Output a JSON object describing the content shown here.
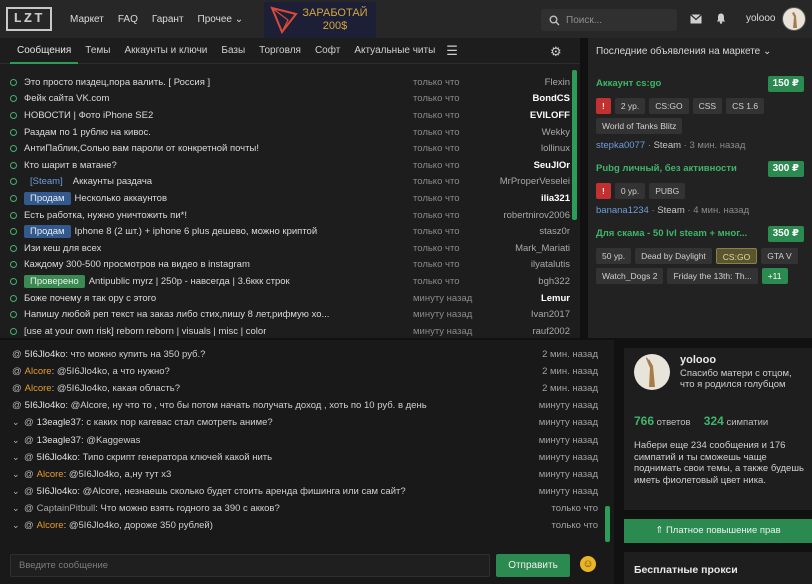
{
  "header": {
    "logo": "LZT",
    "nav": [
      "Маркет",
      "FAQ",
      "Гарант",
      "Прочее ⌄"
    ],
    "banner_text": "ЗАРАБОТАЙ 200$",
    "search_placeholder": "Поиск...",
    "username": "yolooo"
  },
  "tabs": [
    "Сообщения",
    "Темы",
    "Аккаунты и ключи",
    "Базы",
    "Торговля",
    "Софт",
    "Актуальные читы"
  ],
  "threads": [
    {
      "prefix": "",
      "title": "Это просто пиздец,пора валить. [ Россия ]",
      "time": "только что",
      "author": "Flexin",
      "bold": false
    },
    {
      "prefix": "",
      "title": "Фейк сайта VK.com",
      "time": "только что",
      "author": "BondCS",
      "bold": true
    },
    {
      "prefix": "",
      "title": "НОВОСТИ | Фото iPhone SE2",
      "time": "только что",
      "author": "EVILOFF",
      "bold": true
    },
    {
      "prefix": "",
      "title": "Раздам по 1 рублю на кивос.",
      "time": "только что",
      "author": "Wekky",
      "bold": false
    },
    {
      "prefix": "",
      "title": "АнтиПаблик,Солью вам пароли от конкретной почты!",
      "time": "только что",
      "author": "lollinux",
      "bold": false
    },
    {
      "prefix": "",
      "title": "Кто шарит в матане?",
      "time": "только что",
      "author": "SeuJlOr",
      "bold": true
    },
    {
      "prefix": "steam",
      "prefix_text": "[Steam]",
      "title": "Аккаунты раздача",
      "time": "только что",
      "author": "MrProperVeselei",
      "bold": false
    },
    {
      "prefix": "blue",
      "prefix_text": "Продам",
      "title": "Несколько аккаунтов",
      "time": "только что",
      "author": "ilia321",
      "bold": true
    },
    {
      "prefix": "",
      "title": "Есть работка, нужно уничтожить пи*!",
      "time": "только что",
      "author": "robertnirov2006",
      "bold": false
    },
    {
      "prefix": "blue",
      "prefix_text": "Продам",
      "title": "Iphone 8 (2 шт.) + iphone 6 plus дешево, можно криптой",
      "time": "только что",
      "author": "stasz0r",
      "bold": false
    },
    {
      "prefix": "",
      "title": "Изи кеш для всех",
      "time": "только что",
      "author": "Mark_Mariati",
      "bold": false
    },
    {
      "prefix": "",
      "title": "Каждому 300-500 просмотров на видео в instagram",
      "time": "только что",
      "author": "ilyatalutis",
      "bold": false
    },
    {
      "prefix": "green",
      "prefix_text": "Проверено",
      "title": "Antipublic myrz | 250р - навсегда | 3.6ккк строк",
      "time": "только что",
      "author": "bgh322",
      "bold": false
    },
    {
      "prefix": "",
      "title": "Боже почему я так ору с этого",
      "time": "минуту назад",
      "author": "Lemur",
      "bold": true
    },
    {
      "prefix": "",
      "title": "Напишу любой реп текст на заказ либо стих,пишу 8 лет,рифмую хо...",
      "time": "минуту назад",
      "author": "Ivan2017",
      "bold": false
    },
    {
      "prefix": "",
      "title": "[use at your own risk] reborn reborn | visuals | misc | color",
      "time": "минуту назад",
      "author": "rauf2002",
      "bold": false
    }
  ],
  "chat": [
    {
      "reply": false,
      "name": "5I6Jlo4ko",
      "name_color": "white",
      "text": " : что можно купить на 350 руб.?",
      "time": "2 мин. назад"
    },
    {
      "reply": false,
      "name": "Alcore",
      "name_color": "orange",
      "text": " : @5I6Jlo4ko, а что нужно?",
      "time": "2 мин. назад"
    },
    {
      "reply": false,
      "name": "Alcore",
      "name_color": "orange",
      "text": " : @5I6Jlo4ko, какая область?",
      "time": "2 мин. назад"
    },
    {
      "reply": false,
      "name": "5I6Jlo4ko",
      "name_color": "white",
      "text": " : @Alcore, ну что то , что бы потом начать получать доход , хоть по 10 руб. в день",
      "time": "минуту назад"
    },
    {
      "reply": true,
      "name": "13eagle37",
      "name_color": "white",
      "text": " : с каких пор кагевас стал смотреть аниме?",
      "time": "минуту назад"
    },
    {
      "reply": true,
      "name": "13eagle37",
      "name_color": "white",
      "text": " : @Kaggewas",
      "time": "минуту назад"
    },
    {
      "reply": true,
      "name": "5I6Jlo4ko",
      "name_color": "white",
      "text": " : Типо скрипт генератора ключей какой нить",
      "time": "минуту назад"
    },
    {
      "reply": true,
      "name": "Alcore",
      "name_color": "orange",
      "text": " : @5I6Jlo4ko, а,ну тут х3",
      "time": "минуту назад"
    },
    {
      "reply": true,
      "name": "5I6Jlo4ko",
      "name_color": "white",
      "text": " : @Alcore, незнаешь сколько будет стоить аренда фишинга или сам сайт?",
      "time": "минуту назад"
    },
    {
      "reply": true,
      "name": "CaptainPitbull",
      "name_color": "gray",
      "text": " : Что можно взять годного за 390 с акков?",
      "time": "только что"
    },
    {
      "reply": true,
      "name": "Alcore",
      "name_color": "orange",
      "text": " : @5I6Jlo4ko, дороже 350 рублей)",
      "time": "только что"
    }
  ],
  "chat_input_placeholder": "Введите сообщение",
  "send_label": "Отправить",
  "market": {
    "header": "Последние объявления на маркете ⌄",
    "items": [
      {
        "title": "Аккаунт cs:go",
        "price": "150 ₽",
        "tags": [
          {
            "t": "!",
            "c": "red"
          },
          {
            "t": "2 ур.",
            "c": ""
          },
          {
            "t": "CS:GO",
            "c": ""
          },
          {
            "t": "CSS",
            "c": ""
          },
          {
            "t": "CS 1.6",
            "c": ""
          },
          {
            "t": "World of Tanks Blitz",
            "c": ""
          }
        ],
        "seller": "stepka0077",
        "platform": "Steam",
        "time": "3 мин. назад"
      },
      {
        "title": "Pubg личный, без активности",
        "price": "300 ₽",
        "tags": [
          {
            "t": "!",
            "c": "red"
          },
          {
            "t": "0 ур.",
            "c": ""
          },
          {
            "t": "PUBG",
            "c": ""
          }
        ],
        "seller": "banana1234",
        "platform": "Steam",
        "time": "4 мин. назад"
      },
      {
        "title": "Для скама - 50 lvl steam + мног...",
        "price": "350 ₽",
        "tags": [
          {
            "t": "50 ур.",
            "c": ""
          },
          {
            "t": "Dead by Daylight",
            "c": ""
          },
          {
            "t": "CS:GO",
            "c": "yellow"
          },
          {
            "t": "GTA V",
            "c": ""
          },
          {
            "t": "Watch_Dogs 2",
            "c": ""
          },
          {
            "t": "Friday the 13th: Th...",
            "c": ""
          },
          {
            "t": "+11",
            "c": "plus"
          }
        ],
        "seller": "",
        "platform": "",
        "time": ""
      }
    ]
  },
  "profile": {
    "name": "yolooo",
    "status": "Спасибо матери с отцом, что я родился голубцом",
    "posts": "766",
    "posts_label": " ответов",
    "likes": "324",
    "likes_label": " симпатии",
    "note": "Набери еще 234 сообщения и 176 симпатий и ты сможешь чаще поднимать свои темы, а также будешь иметь фиолетовый цвет ника."
  },
  "upgrade_label": "⇑ Платное повышение прав",
  "proxy_label": "Бесплатные прокси"
}
